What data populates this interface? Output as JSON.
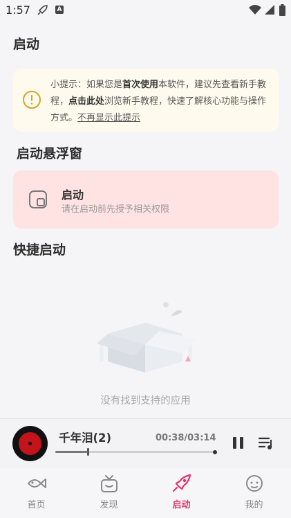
{
  "status_bar": {
    "time": "1:57"
  },
  "headings": {
    "launch": "启动",
    "float_window": "启动悬浮窗",
    "quick_launch": "快捷启动"
  },
  "tip": {
    "prefix": "小提示：如果您是",
    "bold1": "首次使用",
    "mid1": "本软件，建议先查看新手教程，",
    "bold2": "点击此处",
    "mid2": "浏览新手教程，快速了解核心功能与操作方式。",
    "link": "不再显示此提示"
  },
  "float_card": {
    "title": "启动",
    "subtitle": "请在启动前先授予相关权限"
  },
  "empty_state": {
    "text": "没有找到支持的应用"
  },
  "player": {
    "song": "千年泪(2)",
    "time": "00:38/03:14",
    "progress": 0.2
  },
  "nav": [
    {
      "label": "首页"
    },
    {
      "label": "发现"
    },
    {
      "label": "启动"
    },
    {
      "label": "我的"
    }
  ],
  "colors": {
    "accent": "#e8316a",
    "tip_bg": "#fefbee",
    "tip_icon": "#d6a41f",
    "float_bg": "#ffe3e3"
  }
}
